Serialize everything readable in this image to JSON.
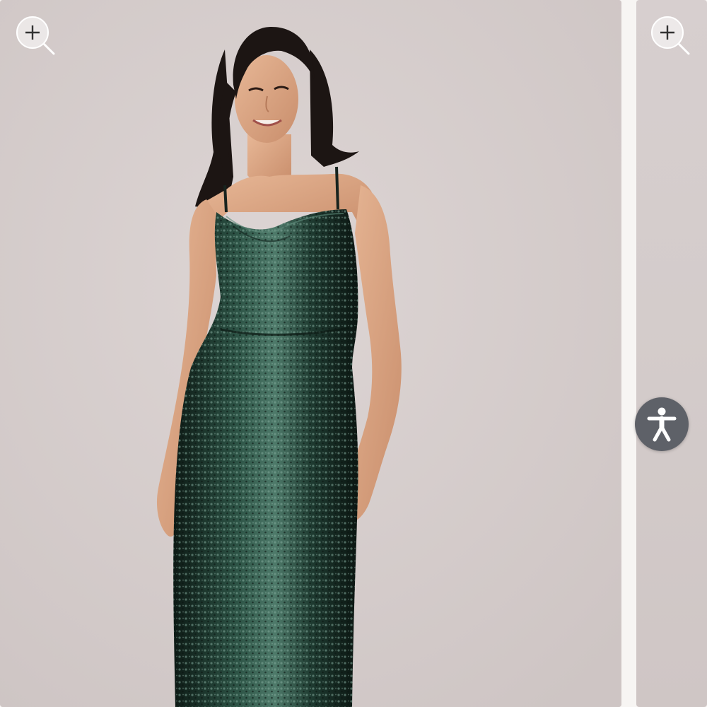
{
  "gallery": {
    "main_image": {
      "alt": "",
      "zoom_icon": "zoom-in-icon"
    },
    "next_image": {
      "zoom_icon": "zoom-in-icon"
    }
  },
  "accessibility": {
    "icon": "accessibility-person-icon"
  },
  "colors": {
    "backdrop": "#d5cdcc",
    "dress": "#1f3a30",
    "accessibility_button": "#5e6168"
  }
}
